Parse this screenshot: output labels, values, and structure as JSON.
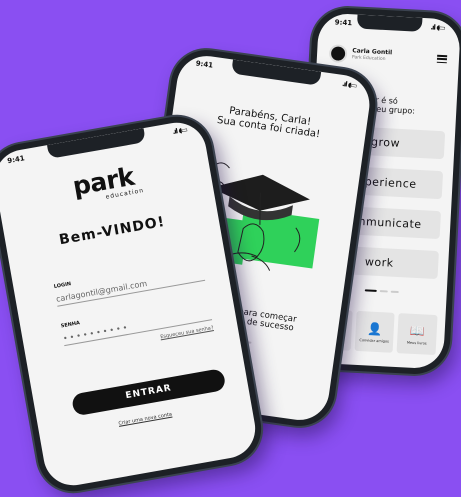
{
  "colors": {
    "background": "#8a4ff2",
    "grow": "#e8d62a",
    "experience": "#2fd15a",
    "communicate": "#9b5cf2",
    "work": "#f0931f",
    "illustration_green": "#2fd15a"
  },
  "login_screen": {
    "time": "9:41",
    "logo": "park",
    "logo_sub": "education",
    "welcome": "Bem-VINDO!",
    "login_label": "LOGIN",
    "login_value": "carlagontil@gmail.com",
    "password_label": "SENHA",
    "password_value": "••••••••••",
    "forgot": "Esqueceu sua senha?",
    "enter_button": "ENTRAR",
    "create_account": "Criar uma nova conta"
  },
  "success_screen": {
    "time": "9:41",
    "title_line1": "Parabéns, Carla!",
    "title_line2": "Sua conta foi criada!",
    "footer_line1": "Prepare-se para começar",
    "footer_line2": "uma jornada de sucesso"
  },
  "groups_screen": {
    "time": "9:41",
    "user_name": "Carla Gontil",
    "user_sub": "Park Education",
    "prompt_line1": "Pra começar é só",
    "prompt_line2": "escolher o seu grupo:",
    "groups": [
      "grow",
      "Experience",
      "communicate",
      "work"
    ],
    "tabs": [
      {
        "label": "Minha sala",
        "icon": "graduation-cap-icon"
      },
      {
        "label": "Convidar amigos",
        "icon": "add-friend-icon"
      },
      {
        "label": "Meus livros",
        "icon": "book-icon"
      }
    ]
  }
}
